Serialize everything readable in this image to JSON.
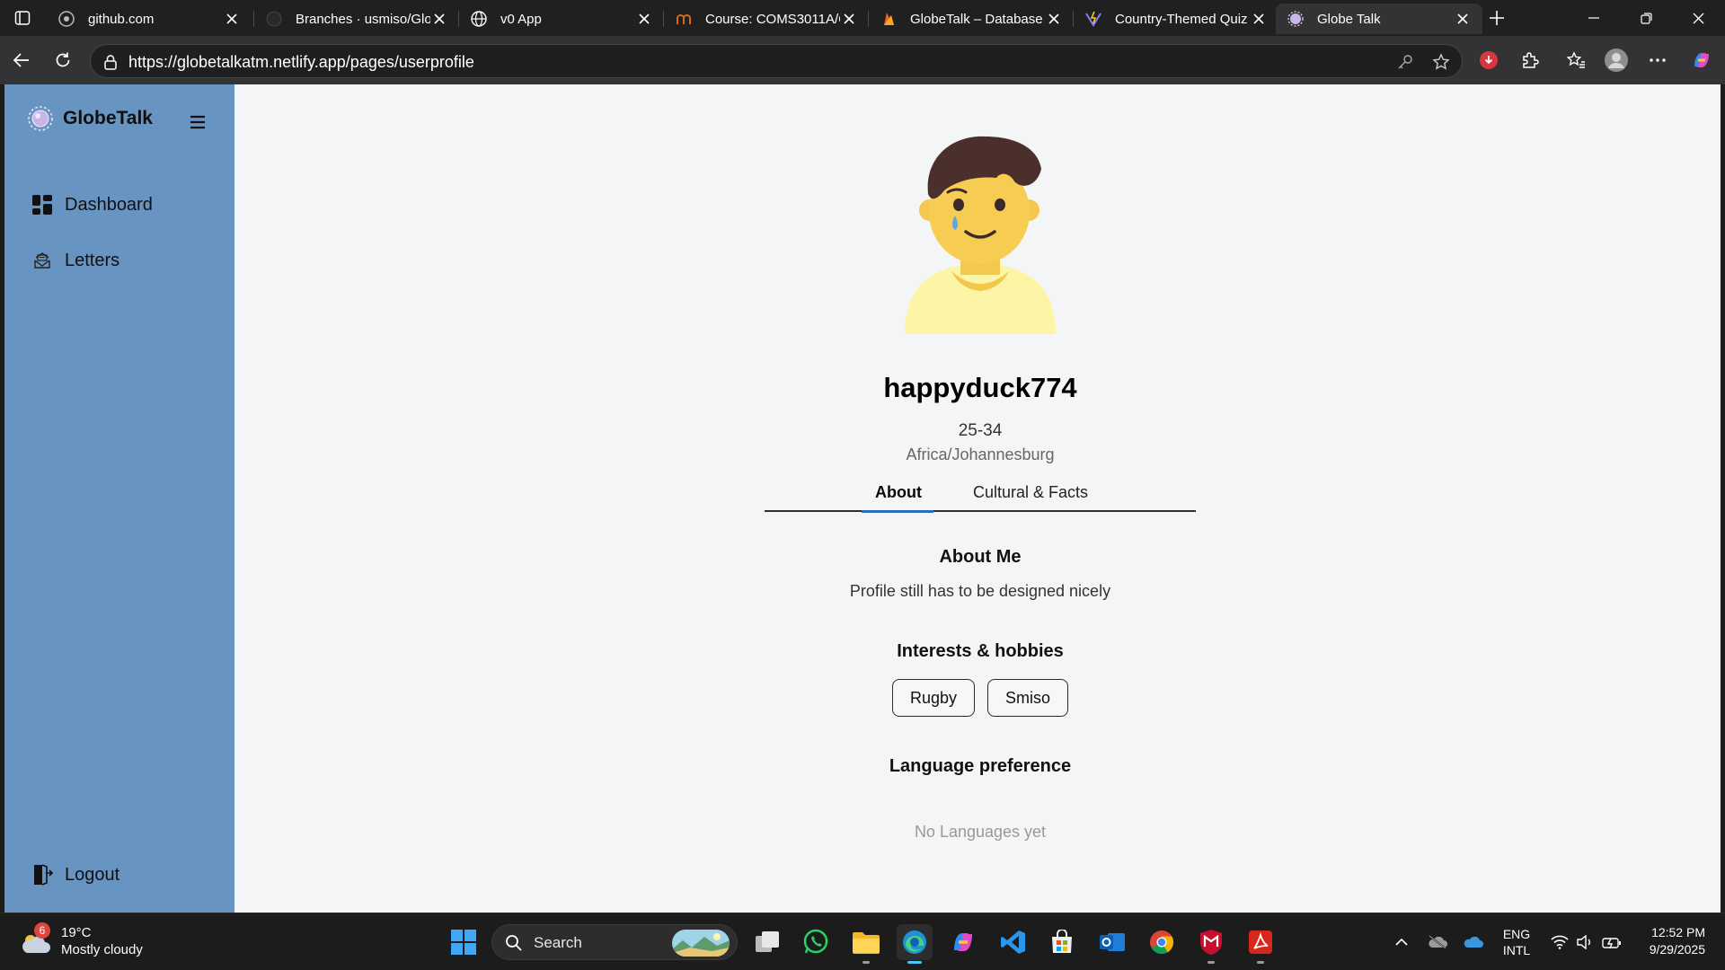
{
  "browser": {
    "tabs": [
      {
        "title": "github.com",
        "icon": "github-icon"
      },
      {
        "title": "Branches · usmiso/Glob",
        "icon": "github-icon"
      },
      {
        "title": "v0 App",
        "icon": "globe-icon"
      },
      {
        "title": "Course: COMS3011A/C",
        "icon": "moodle-icon"
      },
      {
        "title": "GlobeTalk – Database",
        "icon": "firebase-icon"
      },
      {
        "title": "Country-Themed Quiz",
        "icon": "vite-icon"
      },
      {
        "title": "Globe Talk",
        "icon": "globetalk-icon",
        "active": true
      }
    ],
    "url": "https://globetalkatm.netlify.app/pages/userprofile"
  },
  "sidebar": {
    "brand": "GlobeTalk",
    "items": [
      {
        "label": "Dashboard",
        "icon": "dashboard-icon"
      },
      {
        "label": "Letters",
        "icon": "letters-icon"
      }
    ],
    "logout": "Logout"
  },
  "profile": {
    "username": "happyduck774",
    "age_range": "25-34",
    "timezone": "Africa/Johannesburg",
    "tabs": [
      {
        "label": "About",
        "active": true
      },
      {
        "label": "Cultural & Facts",
        "active": false
      }
    ],
    "about_title": "About Me",
    "about_text": "Profile still has to be designed nicely",
    "interests_title": "Interests & hobbies",
    "interests": [
      "Rugby",
      "Smiso"
    ],
    "language_title": "Language preference",
    "language_empty": "No Languages yet"
  },
  "taskbar": {
    "weather_temp": "19°C",
    "weather_desc": "Mostly cloudy",
    "weather_badge": "6",
    "search_label": "Search",
    "lang_top": "ENG",
    "lang_bottom": "INTL",
    "time": "12:52 PM",
    "date": "9/29/2025"
  },
  "colors": {
    "sidebar_bg": "#6894c2",
    "page_bg": "#f4f5f7",
    "tab_accent": "#2c6db8"
  }
}
